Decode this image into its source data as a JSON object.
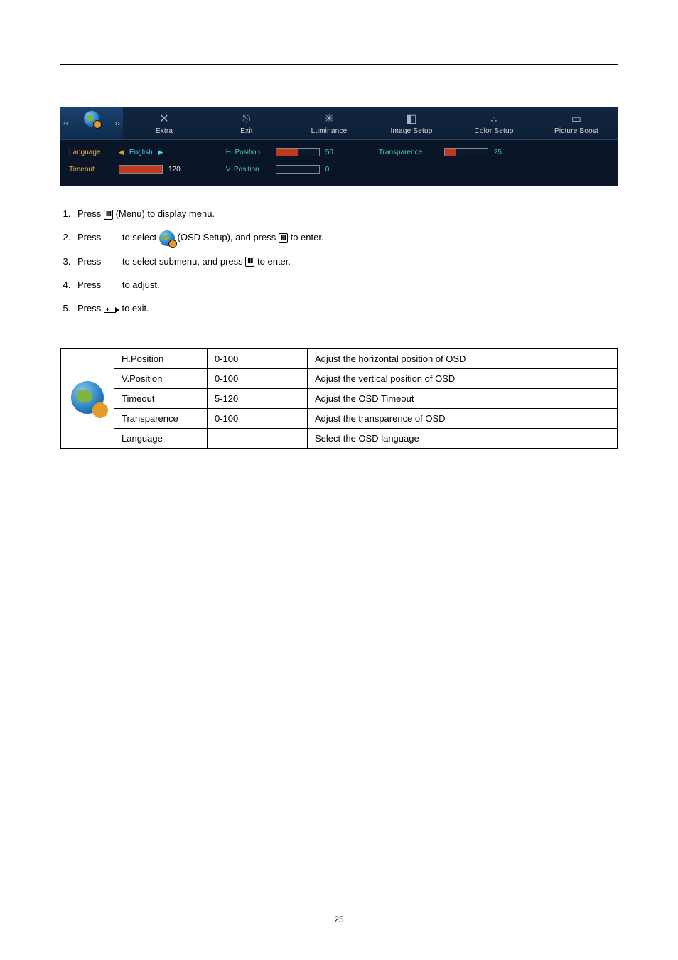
{
  "osd": {
    "tabs": [
      {
        "label": ""
      },
      {
        "label": "Extra"
      },
      {
        "label": "Exit"
      },
      {
        "label": "Luminance"
      },
      {
        "label": "Image Setup"
      },
      {
        "label": "Color Setup"
      },
      {
        "label": "Picture Boost"
      }
    ],
    "settings": {
      "language_label": "Language",
      "language_value": "English",
      "timeout_label": "Timeout",
      "timeout_value": "120",
      "hpos_label": "H. Position",
      "hpos_value": "50",
      "vpos_label": "V. Position",
      "vpos_value": "0",
      "transparence_label": "Transparence",
      "transparence_value": "25"
    }
  },
  "steps": {
    "s1a": "Press ",
    "s1b": " (Menu) to display menu.",
    "s2a": "Press ",
    "s2b": " to select ",
    "s2c": " (OSD Setup), and press ",
    "s2d": " to enter.",
    "s3a": "Press ",
    "s3b": " to select submenu, and press ",
    "s3c": " to enter.",
    "s4a": "Press ",
    "s4b": " to adjust.",
    "s5a": "Press ",
    "s5b": " to exit."
  },
  "table": {
    "rows": [
      {
        "name": "H.Position",
        "range": "0-100",
        "desc": "Adjust the horizontal position of OSD"
      },
      {
        "name": "V.Position",
        "range": "0-100",
        "desc": "Adjust the vertical position of OSD"
      },
      {
        "name": "Timeout",
        "range": "5-120",
        "desc": "Adjust the OSD Timeout"
      },
      {
        "name": "Transparence",
        "range": "0-100",
        "desc": "Adjust the transparence of OSD"
      },
      {
        "name": "Language",
        "range": "",
        "desc": "Select the OSD language"
      }
    ]
  },
  "page_number": "25"
}
